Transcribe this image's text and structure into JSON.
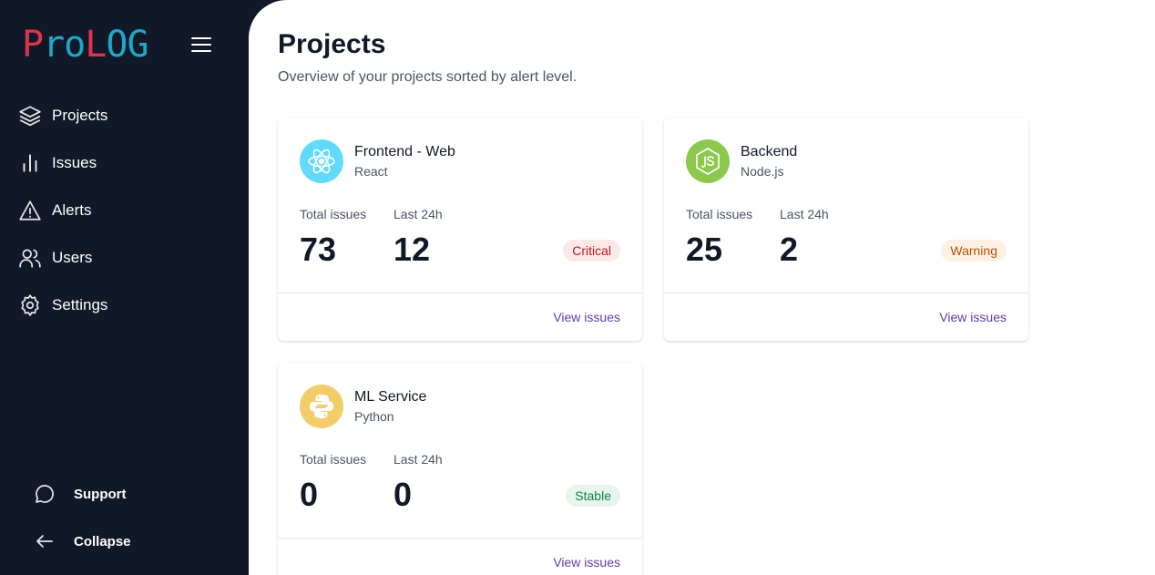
{
  "app": {
    "logo_parts": [
      "P",
      "ro",
      "L",
      "OG"
    ]
  },
  "sidebar": {
    "items": [
      {
        "label": "Projects",
        "icon": "layers-icon"
      },
      {
        "label": "Issues",
        "icon": "bar-chart-icon"
      },
      {
        "label": "Alerts",
        "icon": "alert-triangle-icon"
      },
      {
        "label": "Users",
        "icon": "users-icon"
      },
      {
        "label": "Settings",
        "icon": "gear-icon"
      }
    ],
    "bottom": [
      {
        "label": "Support",
        "icon": "chat-bubble-icon"
      },
      {
        "label": "Collapse",
        "icon": "arrow-left-icon"
      }
    ]
  },
  "page": {
    "title": "Projects",
    "subtitle": "Overview of your projects sorted by alert level."
  },
  "projects": [
    {
      "name": "Frontend - Web",
      "tech": "React",
      "icon": "react-icon",
      "avatar_color": "#61dafb",
      "total_label": "Total issues",
      "total": "73",
      "last_label": "Last 24h",
      "last": "12",
      "status": "Critical",
      "status_bg": "#fde8e8",
      "status_fg": "#b91c1c",
      "link": "View issues"
    },
    {
      "name": "Backend",
      "tech": "Node.js",
      "icon": "nodejs-icon",
      "avatar_color": "#8cc84b",
      "total_label": "Total issues",
      "total": "25",
      "last_label": "Last 24h",
      "last": "2",
      "status": "Warning",
      "status_bg": "#fdf1e4",
      "status_fg": "#b45309",
      "link": "View issues"
    },
    {
      "name": "ML Service",
      "tech": "Python",
      "icon": "python-icon",
      "avatar_color": "#f3cd6a",
      "total_label": "Total issues",
      "total": "0",
      "last_label": "Last 24h",
      "last": "0",
      "status": "Stable",
      "status_bg": "#e6f6ec",
      "status_fg": "#15803d",
      "link": "View issues"
    }
  ]
}
